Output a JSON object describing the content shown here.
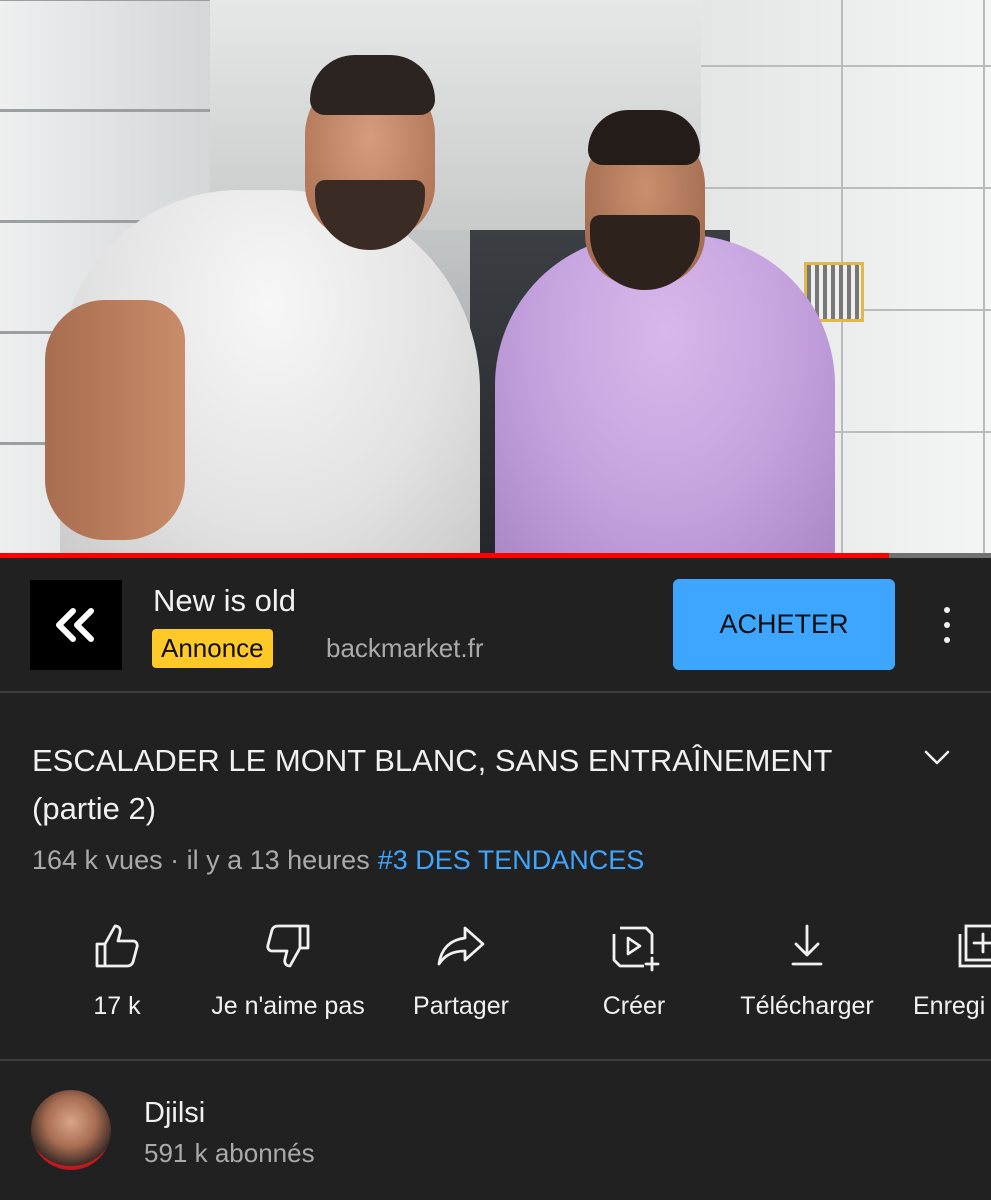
{
  "video": {
    "progress_fraction": 0.897
  },
  "ad": {
    "title": "New is old",
    "badge": "Annonce",
    "domain": "backmarket.fr",
    "cta_label": "ACHETER",
    "logo_icon": "double-chevron-left-icon",
    "more_icon": "more-vert-icon"
  },
  "video_info": {
    "title": "ESCALADER LE MONT BLANC, SANS ENTRAÎNEMENT (partie 2)",
    "views": "164 k vues",
    "separator": " · ",
    "age": "il y a 13 heures",
    "trending": "#3 DES TENDANCES",
    "expand_icon": "chevron-down-icon"
  },
  "actions": [
    {
      "icon": "thumb-up-icon",
      "label": "17 k"
    },
    {
      "icon": "thumb-down-icon",
      "label": "Je n'aime pas"
    },
    {
      "icon": "share-icon",
      "label": "Partager"
    },
    {
      "icon": "create-icon",
      "label": "Créer"
    },
    {
      "icon": "download-icon",
      "label": "Télécharger"
    },
    {
      "icon": "save-playlist-icon",
      "label": "Enregi"
    }
  ],
  "channel": {
    "name": "Djilsi",
    "subscribers": "591 k abonnés"
  },
  "colors": {
    "background": "#212121",
    "accent_blue": "#3ea6ff",
    "badge_yellow": "#ffca28",
    "progress_red": "#ff0000",
    "secondary_text": "#aaaaaa"
  }
}
